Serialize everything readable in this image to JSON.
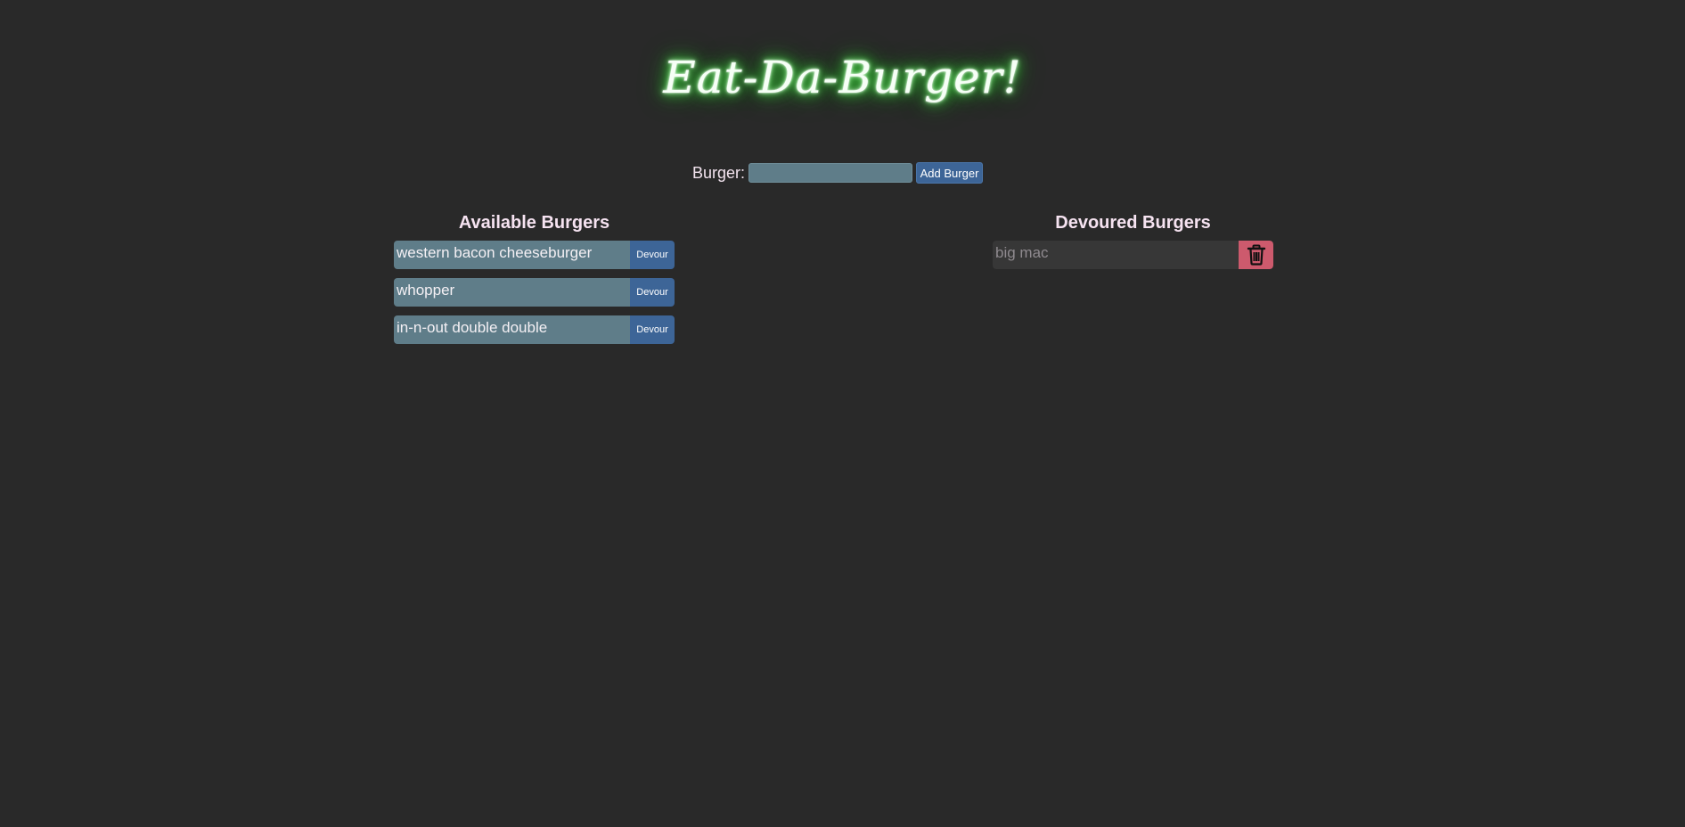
{
  "header": {
    "title": "Eat-Da-Burger!"
  },
  "form": {
    "label": "Burger:",
    "input_value": "",
    "input_placeholder": "",
    "add_button_label": "Add Burger"
  },
  "available": {
    "title": "Available Burgers",
    "devour_label": "Devour",
    "items": [
      {
        "name": "western bacon cheeseburger"
      },
      {
        "name": "whopper"
      },
      {
        "name": "in-n-out double double"
      }
    ]
  },
  "devoured": {
    "title": "Devoured Burgers",
    "delete_icon": "trash-icon",
    "items": [
      {
        "name": "big mac"
      }
    ]
  },
  "colors": {
    "background": "#292929",
    "title_glow": "#45e045",
    "input_bg": "#5f7d89",
    "button_blue": "#3d6597",
    "delete_red": "#cd5a6d"
  }
}
